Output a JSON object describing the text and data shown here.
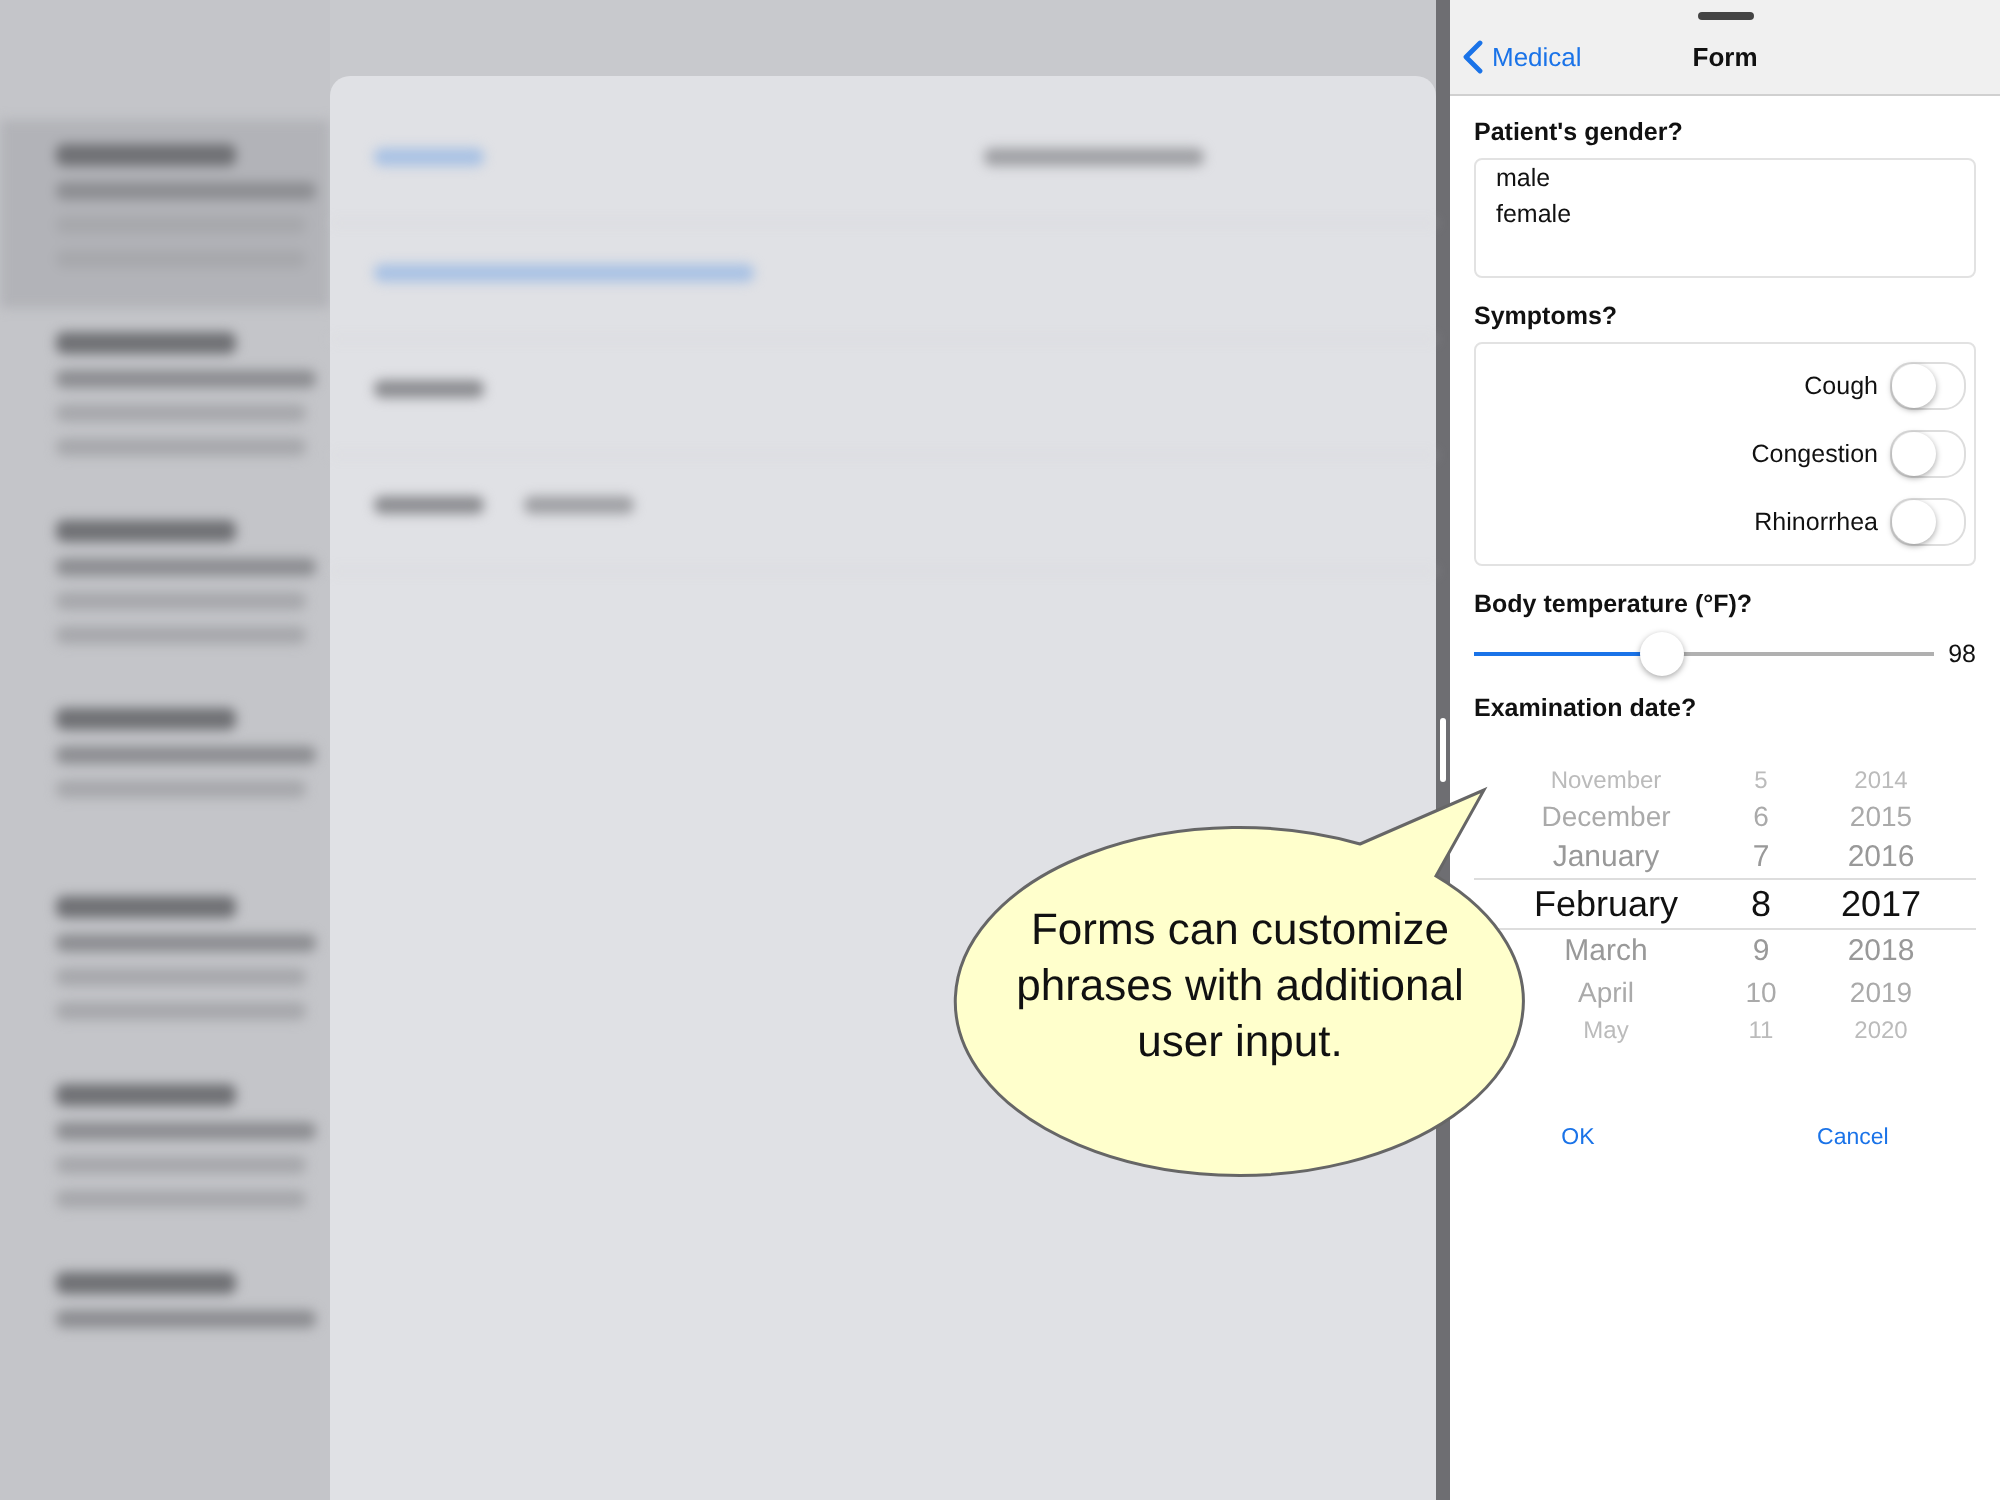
{
  "panel": {
    "back": "Medical",
    "title": "Form"
  },
  "gender": {
    "label": "Patient's gender?",
    "options": [
      "male",
      "female"
    ]
  },
  "symptoms": {
    "label": "Symptoms?",
    "items": [
      {
        "label": "Cough",
        "on": false
      },
      {
        "label": "Congestion",
        "on": false
      },
      {
        "label": "Rhinorrhea",
        "on": false
      }
    ]
  },
  "temperature": {
    "label": "Body temperature (°F)?",
    "level": 0.41,
    "reading": "98"
  },
  "date": {
    "label": "Examination date?",
    "rows": [
      {
        "month": "November",
        "day": "5",
        "year": "2014",
        "selected": false
      },
      {
        "month": "December",
        "day": "6",
        "year": "2015",
        "selected": false
      },
      {
        "month": "January",
        "day": "7",
        "year": "2016",
        "selected": false
      },
      {
        "month": "February",
        "day": "8",
        "year": "2017",
        "selected": true
      },
      {
        "month": "March",
        "day": "9",
        "year": "2018",
        "selected": false
      },
      {
        "month": "April",
        "day": "10",
        "year": "2019",
        "selected": false
      },
      {
        "month": "May",
        "day": "11",
        "year": "2020",
        "selected": false
      }
    ]
  },
  "buttons": [
    "OK",
    "Cancel"
  ],
  "callout": {
    "text": "Forms can customize phrases with additional user input."
  }
}
